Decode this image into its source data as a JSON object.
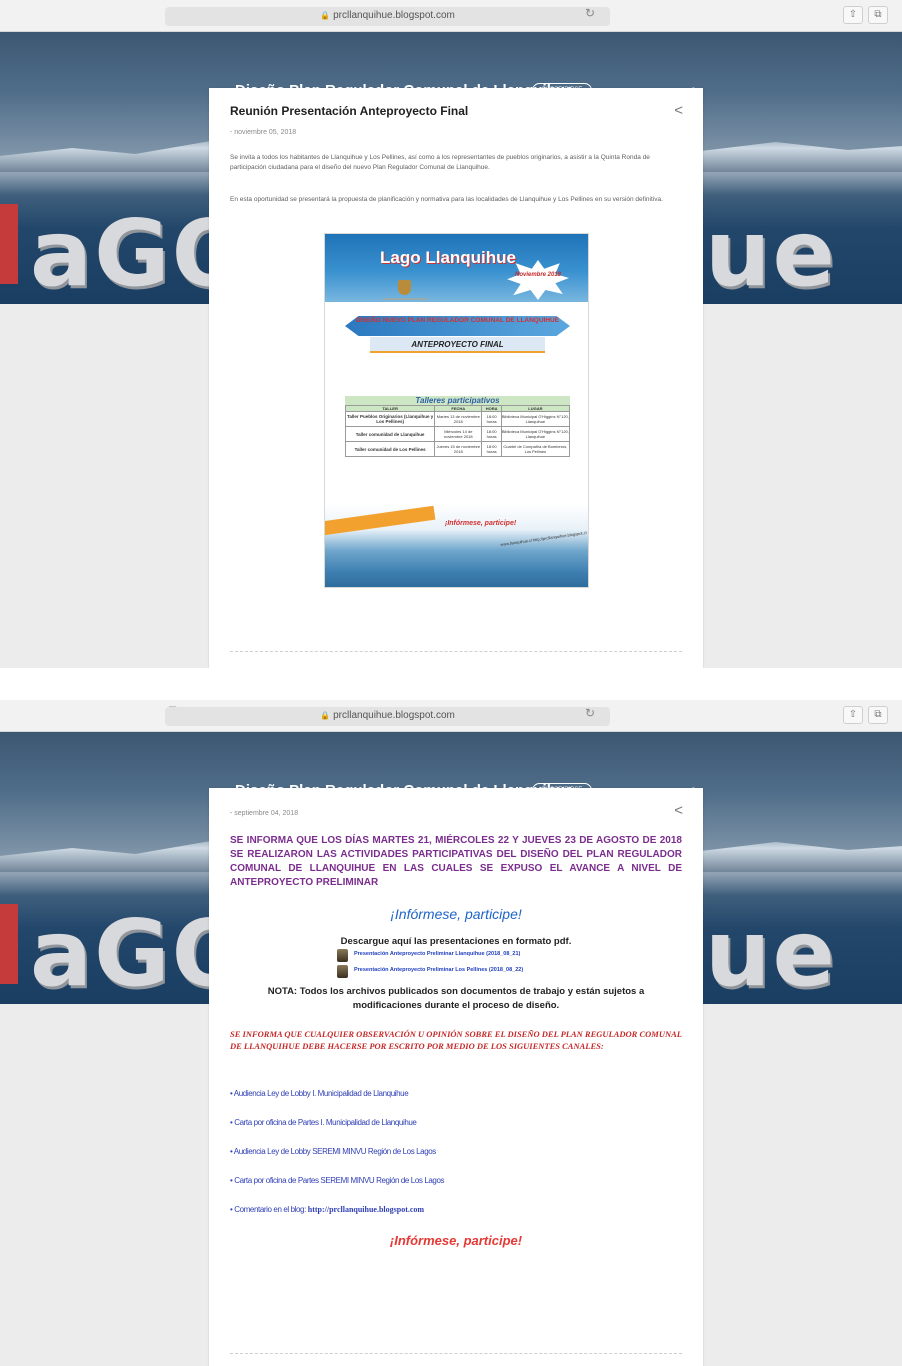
{
  "browser": {
    "url": "prcllanquihue.blogspot.com",
    "lock_icon": "lock-icon",
    "reload_icon": "reload-icon"
  },
  "blog": {
    "back_icon": "back-arrow-icon",
    "title": "Diseño Plan Regulador Comunal de Llanquihue",
    "subscribe_label": "SUSCRIBIRSE",
    "search_icon": "search-icon",
    "hero_text_left": "aGO",
    "hero_text_right": "ue"
  },
  "post1": {
    "title": "Reunión Presentación Anteproyecto Final",
    "date": "- noviembre 05, 2018",
    "paragraph1": "Se invita a todos los habitantes de Llanquihue y Los Pellines, así como a los representantes de pueblos originarios, a asistir a la Quinta Ronda de participación ciudadana para el diseño del nuevo Plan Regulador Comunal de Llanquihue.",
    "paragraph2": "En esta oportunidad se presentará la propuesta de planificación y normativa para las localidades de Llanquihue y Los Pellines en su versión definitiva.",
    "poster": {
      "brand": "Lago Llanquihue",
      "star_text": "Noviembre 2018",
      "banner": "DISEÑO NUEVO PLAN REGULADOR COMUNAL DE LLANQUIHUE",
      "subtitle": "ANTEPROYECTO FINAL",
      "table_title": "Talleres participativos",
      "columns": [
        "TALLER",
        "FECHA",
        "HORA",
        "LUGAR"
      ],
      "rows": [
        [
          "Taller Pueblos Originarios (Llanquihue y Los Pellines)",
          "Martes 13 de noviembre 2018",
          "18:00 horas",
          "Biblioteca Municipal O'Higgins N°120, Llanquihue"
        ],
        [
          "Taller comunidad de Llanquihue",
          "Miércoles 14 de noviembre 2018",
          "18:00 horas",
          "Biblioteca Municipal O'Higgins N°120, Llanquihue"
        ],
        [
          "Taller comunidad de Los Pellines",
          "Jueves 15 de noviembre 2018",
          "18:00 horas",
          "Cuartel de Compañía de Bomberos, Los Pellines"
        ]
      ],
      "informese": "¡Infórmese, participe!",
      "urls": "www.llanquihue.cl  http://prcllanquihue.blogspot.cl"
    }
  },
  "post2": {
    "date": "- septiembre 04, 2018",
    "headline": "SE INFORMA QUE LOS DÍAS MARTES 21, MIÉRCOLES 22 Y JUEVES 23 DE AGOSTO DE 2018 SE REALIZARON LAS ACTIVIDADES PARTICIPATIVAS DEL DISEÑO DEL PLAN REGULADOR COMUNAL DE LLANQUIHUE EN LAS CUALES SE EXPUSO EL AVANCE A NIVEL DE ANTEPROYECTO PRELIMINAR",
    "informese_blue": "¡Infórmese, participe!",
    "download_title": "Descargue aquí las presentaciones en formato pdf.",
    "downloads": [
      "Presentación Anteproyecto Preliminar Llanquihue (2018_08_21)",
      "Presentación Anteproyecto Preliminar Los Pellines (2018_08_22)"
    ],
    "nota_line1": "NOTA: Todos los archivos publicados son documentos de trabajo y están sujetos a",
    "nota_line2": "modificaciones durante el proceso de diseño.",
    "observacion": "SE INFORMA QUE CUALQUIER OBSERVACIÓN U OPINIÓN SOBRE EL DISEÑO DEL PLAN REGULADOR COMUNAL DE LLANQUIHUE DEBE HACERSE POR ESCRITO POR MEDIO DE LOS SIGUIENTES CANALES:",
    "channels": [
      "• Audiencia Ley de Lobby I. Municipalidad de Llanquihue",
      "• Carta por oficina de Partes I. Municipalidad de Llanquihue",
      "• Audiencia Ley de Lobby SEREMI MINVU Región de Los Lagos",
      "• Carta por oficina de Partes SEREMI MINVU Región de Los Lagos",
      "• Comentario en el blog:"
    ],
    "blog_url": "http://prcllanquihue.blogspot.com",
    "informese_red": "¡Infórmese, participe!"
  },
  "colors": {
    "headline_purple": "#7b2d8e",
    "link_blue": "#2f3fb4",
    "accent_red": "#c62828",
    "informese_blue": "#1e64c8"
  }
}
